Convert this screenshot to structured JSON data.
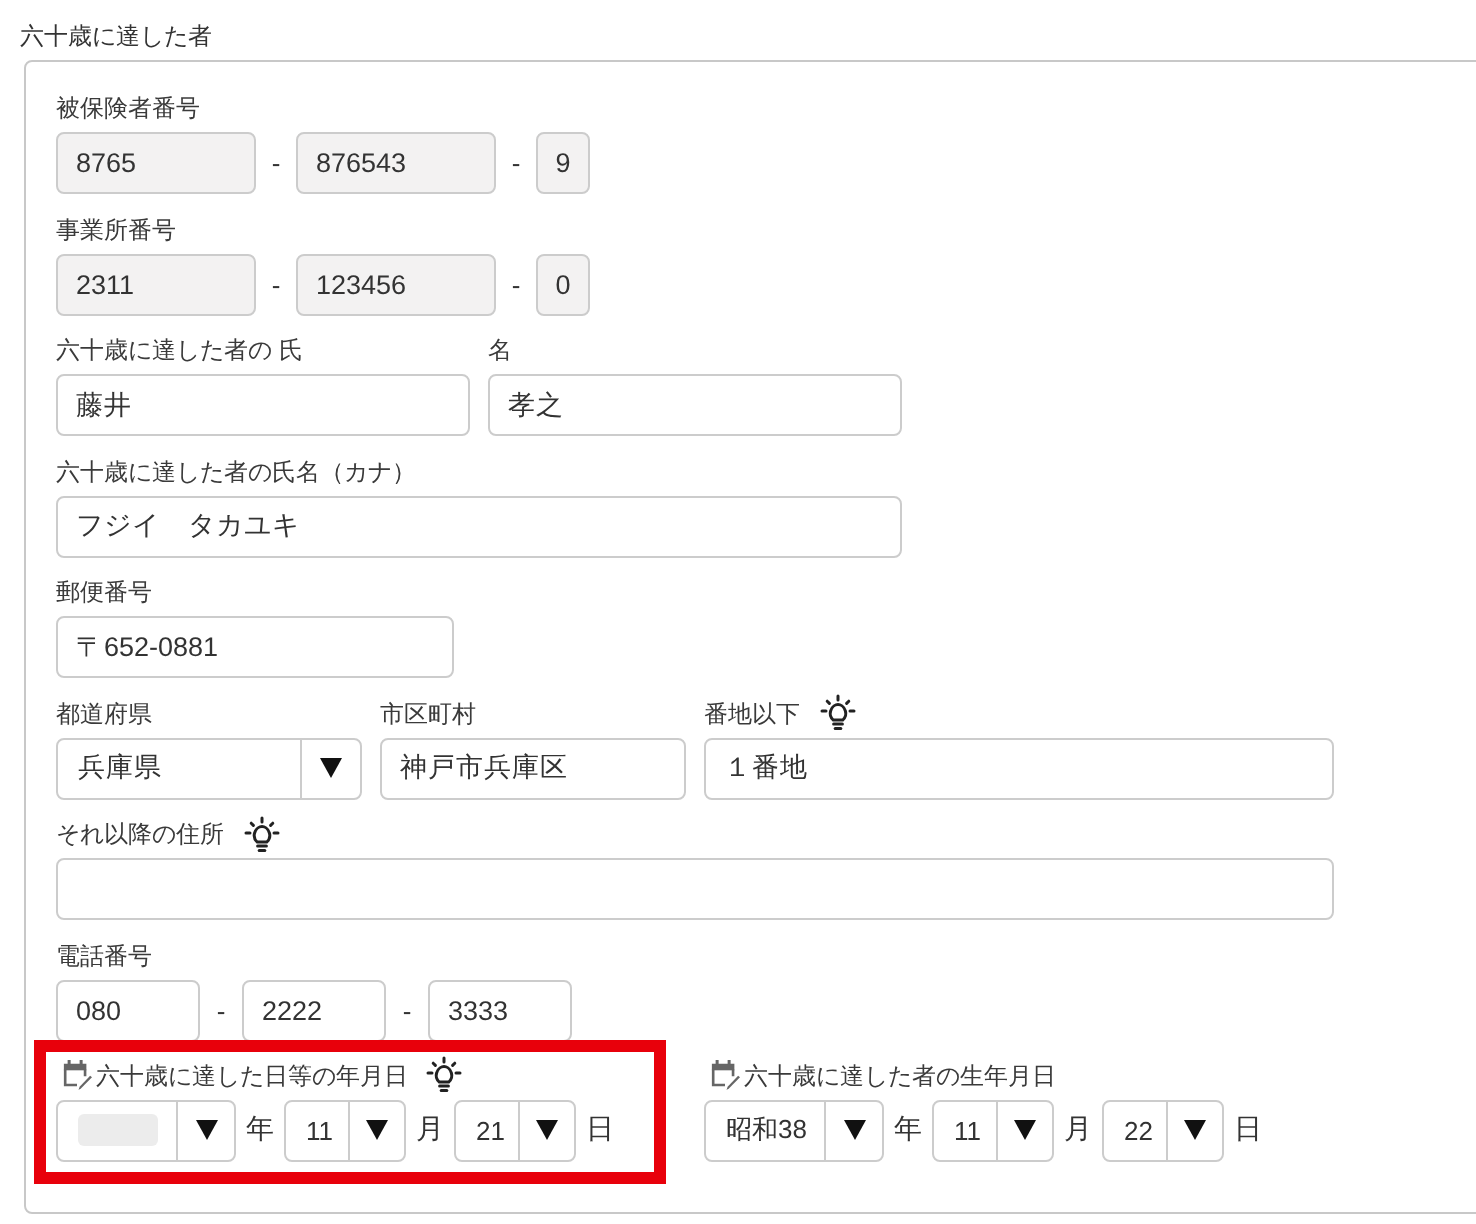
{
  "section_title": "六十歳に達した者",
  "insured_number": {
    "label": "被保険者番号",
    "segments": [
      {
        "kind": "input",
        "value": "8765",
        "readonly": true
      },
      {
        "kind": "separator",
        "text": "-"
      },
      {
        "kind": "input",
        "value": "876543",
        "readonly": true
      },
      {
        "kind": "separator",
        "text": "-"
      },
      {
        "kind": "input",
        "value": "9",
        "readonly": true
      }
    ]
  },
  "office_number": {
    "label": "事業所番号",
    "segments": [
      {
        "kind": "input",
        "value": "2311",
        "readonly": true
      },
      {
        "kind": "separator",
        "text": "-"
      },
      {
        "kind": "input",
        "value": "123456",
        "readonly": true
      },
      {
        "kind": "separator",
        "text": "-"
      },
      {
        "kind": "input",
        "value": "0",
        "readonly": true
      }
    ]
  },
  "name": {
    "family": {
      "label": "六十歳に達した者の 氏",
      "value": "藤井"
    },
    "given": {
      "label": "名",
      "value": "孝之"
    }
  },
  "name_kana": {
    "label": "六十歳に達した者の氏名（カナ）",
    "value": "フジイ　タカユキ"
  },
  "postal_code": {
    "label": "郵便番号",
    "value": "〒652-0881"
  },
  "address": {
    "prefecture": {
      "label": "都道府県",
      "value": "兵庫県"
    },
    "city": {
      "label": "市区町村",
      "value": "神戸市兵庫区"
    },
    "street": {
      "label": "番地以下",
      "value": "１番地",
      "hint": true
    },
    "rest": {
      "label": "それ以降の住所",
      "hint": true
    }
  },
  "phone": {
    "label": "電話番号",
    "segments": [
      {
        "kind": "input",
        "value": "080",
        "readonly": false
      },
      {
        "kind": "separator",
        "text": "-"
      },
      {
        "kind": "input",
        "value": "2222",
        "readonly": false
      },
      {
        "kind": "separator",
        "text": "-"
      },
      {
        "kind": "input",
        "value": "3333",
        "readonly": false
      }
    ]
  },
  "dates": [
    {
      "label": "六十歳に達した日等の年月日",
      "hint": true,
      "highlighted": true,
      "year": {
        "blurred": true
      },
      "year_unit": "年",
      "month": "11",
      "month_unit": "月",
      "day": "21",
      "day_unit": "日"
    },
    {
      "label": "六十歳に達した者の生年月日",
      "hint": false,
      "highlighted": false,
      "year": {
        "value": "昭和38",
        "blurred": false
      },
      "year_unit": "年",
      "month": "11",
      "month_unit": "月",
      "day": "22",
      "day_unit": "日"
    }
  ]
}
